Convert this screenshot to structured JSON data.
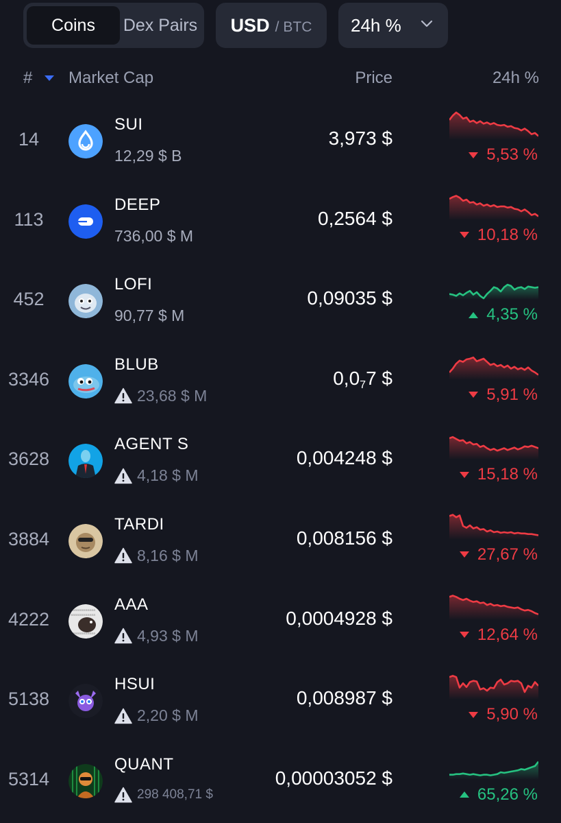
{
  "toolbar": {
    "tabs": [
      {
        "label": "Coins",
        "active": true
      },
      {
        "label": "Dex Pairs",
        "active": false
      }
    ],
    "currency": {
      "primary": "USD",
      "separator": "/",
      "secondary": "BTC"
    },
    "period": {
      "label": "24h %",
      "icon": "chevron-down-icon"
    }
  },
  "table": {
    "headers": {
      "rank": "#",
      "market_cap": "Market Cap",
      "price": "Price",
      "change": "24h %"
    },
    "sort_icon": "sort-desc-triangle-icon",
    "rows": [
      {
        "rank": "14",
        "symbol": "SUI",
        "market_cap": "12,29 $ B",
        "warning": false,
        "price": "3,973 $",
        "change": "5,53 %",
        "direction": "down",
        "spark": [
          32,
          25,
          20,
          24,
          30,
          28,
          35,
          33,
          37,
          34,
          38,
          36,
          39,
          37,
          40,
          41,
          40,
          43,
          42,
          45,
          46,
          49,
          46,
          50,
          55,
          53,
          58
        ]
      },
      {
        "rank": "113",
        "symbol": "DEEP",
        "market_cap": "736,00 $ M",
        "warning": false,
        "price": "0,2564 $",
        "change": "10,18 %",
        "direction": "down",
        "spark": [
          30,
          27,
          25,
          28,
          33,
          31,
          36,
          35,
          39,
          37,
          41,
          39,
          42,
          40,
          43,
          42,
          42,
          44,
          43,
          46,
          47,
          50,
          47,
          51,
          56,
          54,
          58
        ]
      },
      {
        "rank": "452",
        "symbol": "LOFI",
        "market_cap": "90,77 $ M",
        "warning": false,
        "price": "0,09035 $",
        "change": "4,35 %",
        "direction": "up",
        "spark": [
          55,
          56,
          58,
          54,
          57,
          53,
          50,
          56,
          52,
          58,
          62,
          55,
          50,
          44,
          46,
          51,
          44,
          40,
          42,
          48,
          45,
          44,
          47,
          43,
          44,
          45,
          44
        ]
      },
      {
        "rank": "3346",
        "symbol": "BLUB",
        "market_cap": "23,68 $ M",
        "warning": true,
        "price_main": "0,0",
        "price_sub": "7",
        "price_tail": "7 $",
        "change": "5,91 %",
        "direction": "down",
        "spark": [
          52,
          46,
          38,
          33,
          35,
          31,
          30,
          28,
          34,
          32,
          30,
          35,
          40,
          38,
          42,
          40,
          44,
          41,
          46,
          43,
          47,
          45,
          48,
          44,
          49,
          52,
          56
        ]
      },
      {
        "rank": "3628",
        "symbol": "AGENT S",
        "market_cap": "4,18 $ M",
        "warning": true,
        "price": "0,004248 $",
        "change": "15,18 %",
        "direction": "down",
        "spark": [
          30,
          28,
          31,
          34,
          33,
          38,
          36,
          40,
          39,
          44,
          42,
          46,
          49,
          47,
          50,
          48,
          46,
          49,
          47,
          45,
          48,
          46,
          43,
          44,
          42,
          44,
          46
        ]
      },
      {
        "rank": "3884",
        "symbol": "TARDI",
        "market_cap": "8,16 $ M",
        "warning": true,
        "price": "0,008156 $",
        "change": "27,67 %",
        "direction": "down",
        "spark": [
          26,
          24,
          28,
          25,
          42,
          45,
          41,
          46,
          44,
          48,
          47,
          51,
          49,
          52,
          51,
          53,
          52,
          53,
          52,
          54,
          53,
          54,
          54,
          55,
          55,
          56,
          57
        ]
      },
      {
        "rank": "4222",
        "symbol": "AAA",
        "market_cap": "4,93 $ M",
        "warning": true,
        "price": "0,0004928 $",
        "change": "12,64 %",
        "direction": "down",
        "spark": [
          27,
          25,
          27,
          30,
          32,
          30,
          33,
          35,
          34,
          37,
          36,
          40,
          38,
          41,
          40,
          42,
          41,
          43,
          44,
          45,
          44,
          47,
          49,
          48,
          50,
          53,
          55
        ]
      },
      {
        "rank": "5138",
        "symbol": "HSUI",
        "market_cap": "2,20 $ M",
        "warning": true,
        "price": "0,008987 $",
        "change": "5,90 %",
        "direction": "down",
        "spark": [
          28,
          26,
          28,
          45,
          38,
          44,
          36,
          34,
          35,
          48,
          46,
          50,
          45,
          46,
          36,
          32,
          40,
          38,
          34,
          35,
          34,
          38,
          52,
          42,
          45,
          36,
          42
        ]
      },
      {
        "rank": "5314",
        "symbol": "QUANT",
        "market_cap": "298 408,71 $",
        "warning": true,
        "price": "0,00003052 $",
        "change": "65,26 %",
        "direction": "up",
        "spark": [
          56,
          56,
          55,
          55,
          54,
          55,
          56,
          55,
          56,
          57,
          56,
          56,
          57,
          56,
          55,
          52,
          53,
          52,
          51,
          50,
          49,
          47,
          48,
          46,
          44,
          42,
          35
        ]
      }
    ]
  },
  "colors": {
    "background": "#151720",
    "panel": "#262a36",
    "down": "#ee3b44",
    "up": "#26c281",
    "accent": "#3b6df6"
  }
}
